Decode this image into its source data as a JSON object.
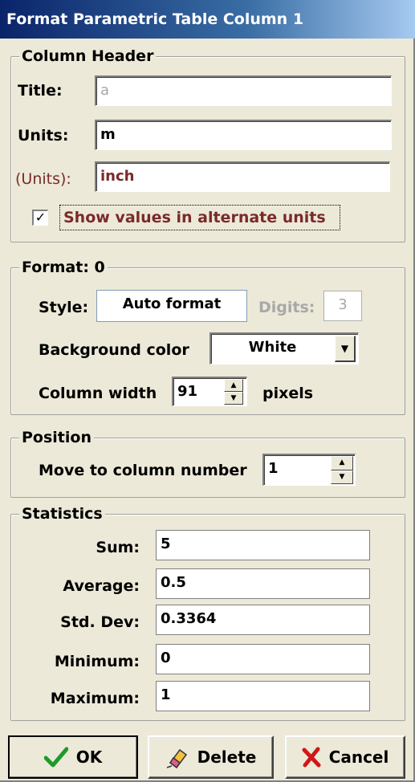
{
  "window": {
    "title": "Format Parametric Table Column 1"
  },
  "column_header": {
    "legend": "Column Header",
    "title_label": "Title:",
    "title_value": "a",
    "units_label": "Units:",
    "units_value": "m",
    "alt_units_label": "(Units):",
    "alt_units_value": "inch",
    "show_alt_label": "Show values in alternate units",
    "show_alt_checked": true
  },
  "format": {
    "legend": "Format: 0",
    "style_label": "Style:",
    "style_value": "Auto format",
    "digits_label": "Digits:",
    "digits_value": "3",
    "bg_label": "Background color",
    "bg_value": "White",
    "width_label": "Column width",
    "width_value": "91",
    "width_unit": "pixels"
  },
  "position": {
    "legend": "Position",
    "move_label": "Move to column number",
    "move_value": "1"
  },
  "statistics": {
    "legend": "Statistics",
    "rows": [
      {
        "label": "Sum:",
        "value": "5"
      },
      {
        "label": "Average:",
        "value": "0.5"
      },
      {
        "label": "Std. Dev:",
        "value": "0.3364"
      },
      {
        "label": "Minimum:",
        "value": "0"
      },
      {
        "label": "Maximum:",
        "value": "1"
      }
    ]
  },
  "buttons": {
    "ok": "OK",
    "delete": "Delete",
    "cancel": "Cancel"
  },
  "icons": {
    "ok": "checkmark-icon",
    "delete": "eraser-icon",
    "cancel": "red-x-icon"
  },
  "colors": {
    "title_gradient_start": "#0a246a",
    "title_gradient_end": "#a6caf0",
    "dialog_bg": "#ece9d8",
    "alt_units_text": "#7a2a2a",
    "ok_check": "#1e9a2c",
    "cancel_x": "#d01818"
  }
}
